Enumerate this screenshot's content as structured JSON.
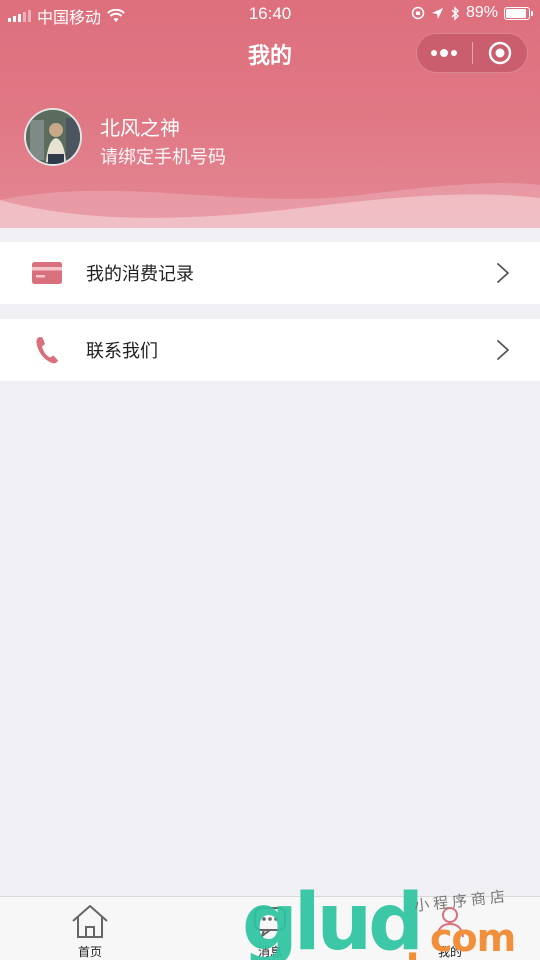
{
  "status_bar": {
    "carrier": "中国移动",
    "time": "16:40",
    "battery": "89%",
    "battery_level": 0.89
  },
  "nav": {
    "title": "我的",
    "more_icon": "more-dots-icon",
    "close_icon": "target-circle-icon"
  },
  "profile": {
    "name": "北风之神",
    "subtitle": "请绑定手机号码"
  },
  "menu": [
    {
      "label": "我的消费记录",
      "icon": "card-icon"
    },
    {
      "label": "联系我们",
      "icon": "phone-icon"
    }
  ],
  "tabbar": [
    {
      "label": "首页",
      "icon": "home-icon"
    },
    {
      "label": "消息",
      "icon": "message-icon"
    },
    {
      "label": "我的",
      "icon": "user-icon"
    }
  ],
  "colors": {
    "accent": "#de6f7d",
    "icon": "#d9707e",
    "background": "#efeff4"
  },
  "watermark": {
    "letters": "glud",
    "domain": "com",
    "script": "小程序商店"
  }
}
